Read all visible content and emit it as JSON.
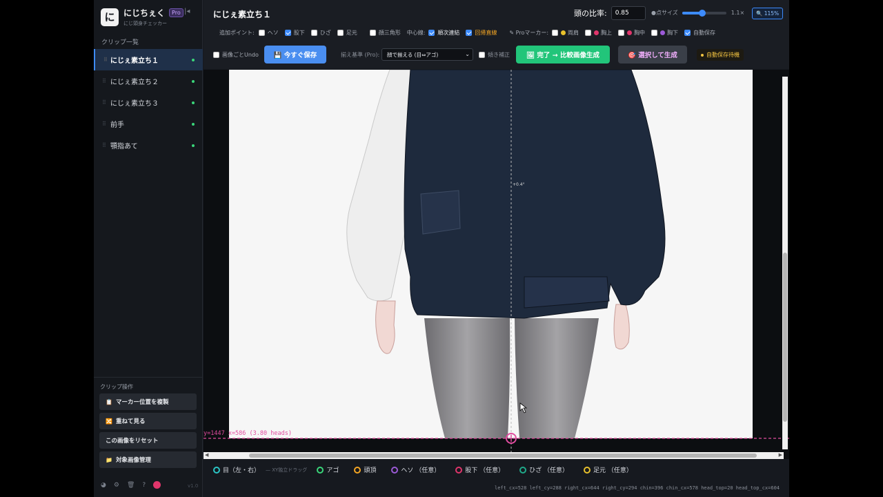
{
  "brand": {
    "logo_char": "に",
    "name": "にじちぇく",
    "badge": "Pro",
    "subtitle": "にじ頭身チェッカー"
  },
  "sidebar": {
    "section_title": "クリップ一覧",
    "clips": [
      {
        "label": "にじぇ素立ち１",
        "active": true
      },
      {
        "label": "にじぇ素立ち２",
        "active": false
      },
      {
        "label": "にじぇ素立ち３",
        "active": false
      },
      {
        "label": "前手",
        "active": false
      },
      {
        "label": "顎指あて",
        "active": false
      }
    ],
    "ops_title": "クリップ操作",
    "ops": [
      {
        "icon": "📋",
        "label": "マーカー位置を複製"
      },
      {
        "icon": "🔀",
        "label": "重ねて見る"
      },
      {
        "icon": "",
        "label": "この画像をリセット"
      },
      {
        "icon": "📁",
        "label": "対象画像管理"
      }
    ],
    "version": "v1.0"
  },
  "header": {
    "clip_title": "にじぇ素立ち１",
    "ratio_label": "頭の比率:",
    "ratio_value": "0.85",
    "point_size_label": "●点サイズ",
    "point_size_value": "1.1×",
    "point_size_level": 0.45,
    "zoom": "🔍 115%",
    "extra_points_label": "追加ポイント:",
    "extra_points": [
      {
        "label": "ヘソ",
        "checked": false
      },
      {
        "label": "股下",
        "checked": true
      },
      {
        "label": "ひざ",
        "checked": false
      },
      {
        "label": "足元",
        "checked": false
      }
    ],
    "triangle": {
      "label": "顔三角形",
      "checked": false
    },
    "center_label": "中心線:",
    "center_options": [
      {
        "label": "順次連結",
        "checked": true
      },
      {
        "label": "回帰直線",
        "checked": true
      }
    ],
    "pro_marker_label": "✎ Proマーカー:",
    "pro_markers": [
      {
        "label": "両肩",
        "checked": false,
        "color": "#e8c12c"
      },
      {
        "label": "胸上",
        "checked": false,
        "color": "#e0356b"
      },
      {
        "label": "胸中",
        "checked": false,
        "color": "#e0356b"
      },
      {
        "label": "胸下",
        "checked": false,
        "color": "#9c5ad8"
      }
    ],
    "autosave": {
      "label": "自動保存",
      "checked": true
    },
    "undo": {
      "label": "画像ごとUndo",
      "checked": false
    },
    "save_button": "💾 今すぐ保存",
    "align_label": "揃え基準 (Pro):",
    "align_value": "顔で揃える (目⇔アゴ)",
    "tilt": {
      "label": "傾き補正",
      "checked": false
    },
    "done_button": "🖼 完了 → 比較画像生成",
    "select_button": "🎯 選択して生成",
    "autosave_status": "自動保存待機"
  },
  "canvas": {
    "marker_readout": "y=1447 x=586  (3.80 heads)",
    "angle_readout": "+0.4°"
  },
  "legend": {
    "items": [
      {
        "label": "目（左・右）",
        "color": "#2bc6c6"
      },
      {
        "label": "アゴ",
        "color": "#3ad67a"
      },
      {
        "label": "頭頂",
        "color": "#f5a623"
      },
      {
        "label": "ヘソ （任意）",
        "color": "#9c5ad8"
      },
      {
        "label": "股下 （任意）",
        "color": "#e0356b"
      },
      {
        "label": "ひざ （任意）",
        "color": "#1faa8a"
      },
      {
        "label": "足元 （任意）",
        "color": "#e8c12c"
      }
    ],
    "eye_note": "— XY独立ドラッグ",
    "coords": "left_cx=528 left_cy=288 right_cx=644 right_cy=294 chin=396 chin_cx=578 head_top=20 head_top_cx=604"
  },
  "colors": {
    "accent": "#3d8bfd",
    "marker": "#e24da0",
    "done": "#22c57a"
  }
}
